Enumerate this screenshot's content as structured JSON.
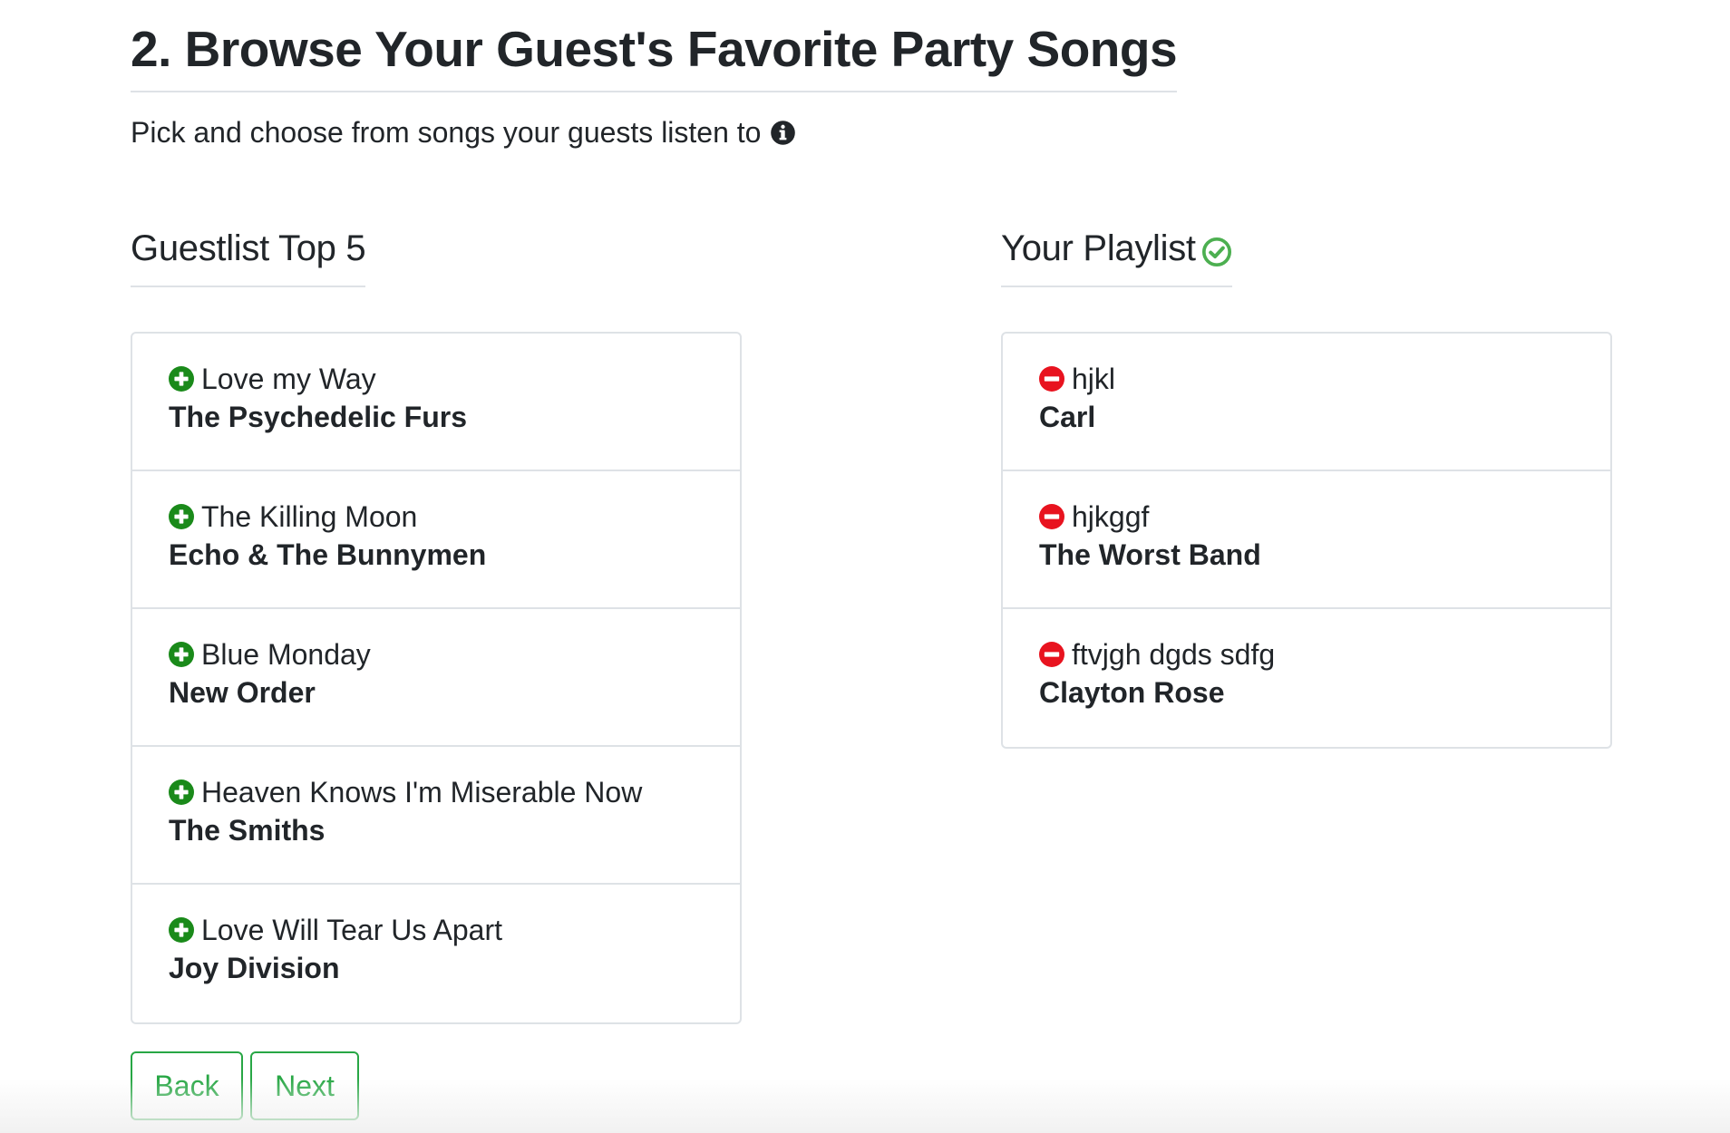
{
  "header": {
    "title": "2. Browse Your Guest's Favorite Party Songs",
    "subtitle": "Pick and choose from songs your guests listen to"
  },
  "guestlist": {
    "heading": "Guestlist Top 5",
    "items": [
      {
        "title": "Love my Way",
        "artist": "The Psychedelic Furs"
      },
      {
        "title": "The Killing Moon",
        "artist": "Echo & The Bunnymen"
      },
      {
        "title": "Blue Monday",
        "artist": "New Order"
      },
      {
        "title": "Heaven Knows I'm Miserable Now",
        "artist": "The Smiths"
      },
      {
        "title": "Love Will Tear Us Apart",
        "artist": "Joy Division"
      }
    ]
  },
  "playlist": {
    "heading": "Your Playlist",
    "items": [
      {
        "title": "hjkl",
        "artist": "Carl"
      },
      {
        "title": "hjkggf",
        "artist": "The Worst Band"
      },
      {
        "title": "ftvjgh dgds sdfg",
        "artist": "Clayton Rose"
      }
    ]
  },
  "buttons": {
    "back_label": "Back",
    "next_label": "Next"
  },
  "icons": {
    "info": "info-circle-icon",
    "add": "plus-circle-icon",
    "remove": "minus-circle-icon",
    "check": "check-circle-icon"
  },
  "colors": {
    "add": "#1a8a1a",
    "remove": "#e8131f",
    "check": "#4caf50",
    "button": "#28a745",
    "text": "#212529",
    "border": "#dee2e6"
  }
}
